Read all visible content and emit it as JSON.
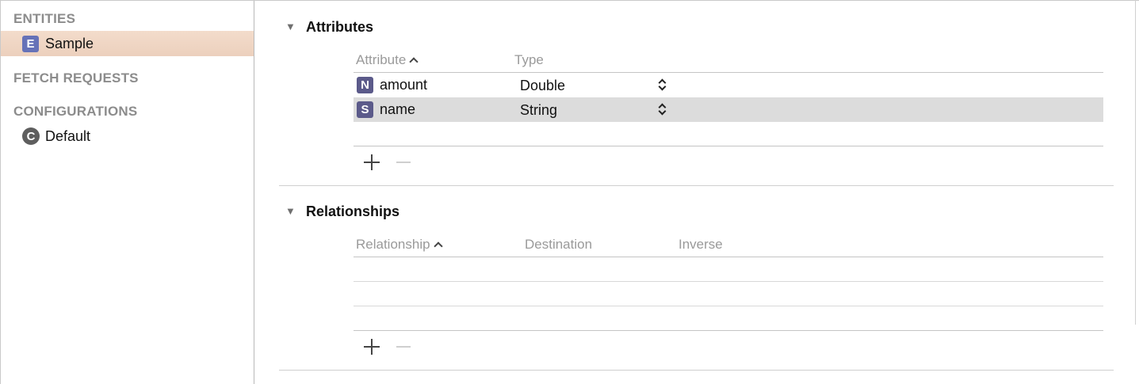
{
  "sidebar": {
    "entities_header": "ENTITIES",
    "entities": [
      {
        "badge": "E",
        "label": "Sample",
        "selected": true
      }
    ],
    "fetch_requests_header": "FETCH REQUESTS",
    "configurations_header": "CONFIGURATIONS",
    "configurations": [
      {
        "badge": "C",
        "label": "Default"
      }
    ]
  },
  "attributes": {
    "title": "Attributes",
    "columns": {
      "attribute": "Attribute",
      "type": "Type"
    },
    "rows": [
      {
        "badge": "N",
        "name": "amount",
        "type": "Double",
        "selected": false
      },
      {
        "badge": "S",
        "name": "name",
        "type": "String",
        "selected": true
      }
    ]
  },
  "relationships": {
    "title": "Relationships",
    "columns": {
      "relationship": "Relationship",
      "destination": "Destination",
      "inverse": "Inverse"
    },
    "rows": []
  },
  "icons": {
    "disclosure": "disclosure-triangle-down-icon",
    "sort": "sort-ascending-icon",
    "add": "plus-icon",
    "remove": "minus-icon",
    "stepper": "popup-stepper-icon"
  },
  "colors": {
    "sidebar_selection": "#ecd0bd",
    "entity_badge": "#6672b8",
    "attribute_badge": "#5b5a8a",
    "row_selection": "#dcdcdc"
  }
}
